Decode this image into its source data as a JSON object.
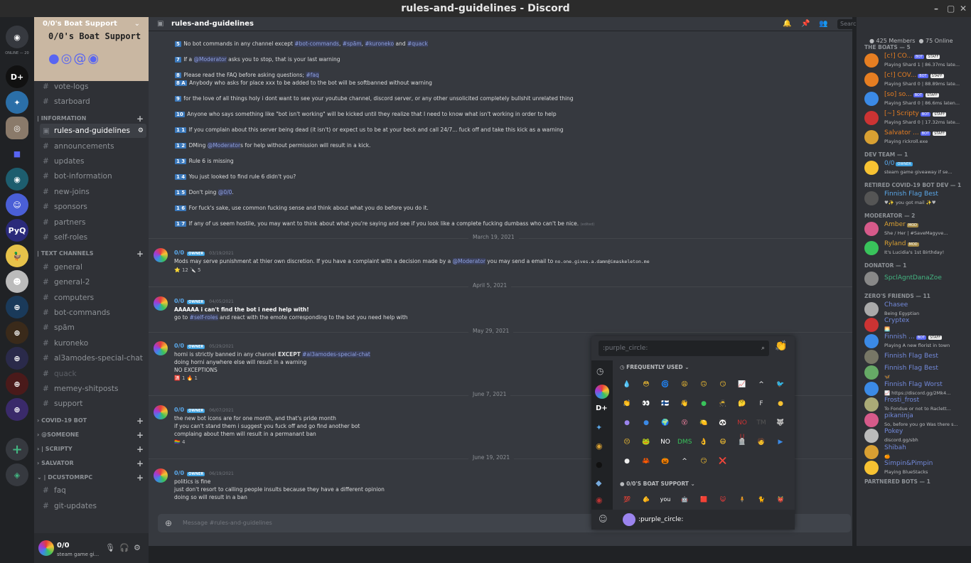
{
  "window": {
    "title": "rules-and-guidelines - Discord"
  },
  "guild_rail": {
    "online_label": "ONLINE — 20"
  },
  "server": {
    "name": "0/0's Boat Support",
    "banner_title": "0/0's Boat Support"
  },
  "channels": {
    "top": [
      "vote-logs",
      "starboard"
    ],
    "categories": [
      {
        "name": "| INFORMATION",
        "items": [
          "rules-and-guidelines",
          "announcements",
          "updates",
          "bot-information",
          "new-joins",
          "sponsors",
          "partners",
          "self-roles"
        ]
      },
      {
        "name": "| TEXT CHANNELS",
        "items": [
          "general",
          "general-2",
          "computers",
          "bot-commands",
          "spām",
          "kuroneko",
          "al3amodes-special-chat",
          "quack",
          "memey-shitposts",
          "support"
        ]
      },
      {
        "name": "COVID-19 BOT"
      },
      {
        "name": "@SOMEONE"
      },
      {
        "name": "| SCRIPTY"
      },
      {
        "name": "SALVATOR"
      },
      {
        "name": "| DCUSTOMRPC",
        "items": [
          "faq",
          "git-updates"
        ]
      }
    ]
  },
  "user_panel": {
    "name": "0/0",
    "status": "steam game gi..."
  },
  "header": {
    "channel": "rules-and-guidelines",
    "search_placeholder": "Search"
  },
  "rules": [
    {
      "n": "5",
      "text": "No bot commands in any channel except",
      "m1": "#bot-commands",
      "m2": "#spām",
      "m3": "#kuroneko",
      "and": "and",
      "m4": "#quack"
    },
    {
      "n": "7",
      "pre": "If a",
      "m": "@Moderator",
      "text": "asks you to stop, that is your last warning"
    },
    {
      "n": "8",
      "text": "Please read the FAQ before asking questions;",
      "m": "#faq"
    },
    {
      "n": "8 A",
      "text": "Anybody who asks for place xxx to be added to the bot will be softbanned without warning"
    },
    {
      "n": "9",
      "text": "for the love of all things holy i dont want to see your youtube channel, discord server, or any other unsolicited completely bullshit unrelated thing"
    },
    {
      "n": "10",
      "text": "Anyone who says something like \"bot isn't working\" will be kicked until they realize that I need to know what isn't working in order to help"
    },
    {
      "n": "1 1",
      "text": "If you complain about this server being dead (it isn't) or expect us to be at your beck and call 24/7... fuck off and take this kick as a warning"
    },
    {
      "n": "1 2",
      "pre": "DMing",
      "m": "@Moderator",
      "text": "s for help without permission will result in a kick."
    },
    {
      "n": "1 3",
      "text": "Rule 6 is missing"
    },
    {
      "n": "1 4",
      "text": "You just looked to find rule 6 didn't you?"
    },
    {
      "n": "1 5",
      "pre": "Don't ping",
      "m": "@0/0",
      "text": "."
    },
    {
      "n": "1 6",
      "text": "For fuck's sake, use common fucking sense and think about what you do before you do it."
    },
    {
      "n": "1 7",
      "text": "If any of us seem hostile, you may want to think about what you're saying and see if you look like a complete fucking dumbass who can't be nice.",
      "edited": "(edited)"
    }
  ],
  "messages": [
    {
      "divider": "March 19, 2021",
      "author": "0/0",
      "badge": "OWNER",
      "date": "03/19/2021",
      "lines": [
        "Mods may serve punishment at thier own discretion. If you have a complaint with a decision made by a",
        "@Moderator",
        "you may send a email to",
        "no.one.gives.a.damn@imaskeleton.me"
      ],
      "reactions": "⭐ 12   🔪 5"
    },
    {
      "divider": "April 5, 2021",
      "author": "0/0",
      "badge": "OWNER",
      "date": "04/05/2021",
      "lines": [
        "AAAAAA i can't find the bot i need help with!",
        "go to",
        "#self-roles",
        "and react with the emote corresponding to the bot you need help with"
      ]
    },
    {
      "divider": "May 29, 2021",
      "author": "0/0",
      "badge": "OWNER",
      "date": "05/29/2021",
      "lines": [
        "horni is strictly banned in any channel",
        "EXCEPT",
        "#al3amodes-special-chat",
        "doing horni anywhere else will result in a warning",
        "NO EXCEPTIONS"
      ],
      "reactions": "🈵 1   🔥 1"
    },
    {
      "divider": "June 7, 2021",
      "author": "0/0",
      "badge": "OWNER",
      "date": "06/07/2021",
      "lines": [
        "the new bot icons are for one month, and that's pride month",
        "if you can't stand them i suggest you fuck off and go find another bot",
        "complaing about them will result in a permanant ban"
      ],
      "reactions": "🏳️‍🌈 4"
    },
    {
      "divider": "June 19, 2021",
      "author": "0/0",
      "badge": "OWNER",
      "date": "06/19/2021",
      "lines": [
        "politics is fine",
        "just don't resort to calling people insults because they have a different opinion",
        "doing so will result in a ban"
      ]
    }
  ],
  "composer": {
    "placeholder": "Message #rules-and-guidelines"
  },
  "emoji_picker": {
    "search_placeholder": ":purple_circle:",
    "frequently_used": "FREQUENTLY USED",
    "server_section": "0/0'S BOAT SUPPORT",
    "footer_name": ":purple_circle:",
    "emojis": [
      "💧",
      "😳",
      "🌀",
      "😫",
      "🙃",
      "😏",
      "📈",
      "^",
      "🐦",
      "👏",
      "👀",
      "🇫🇮",
      "👋",
      "●",
      "🥷",
      "🤔",
      "F",
      "●",
      "●",
      "●",
      "🌍",
      "😵",
      "🍋",
      "🐼",
      "NO U",
      "TM",
      "🐺",
      "😣",
      "🐸",
      "NO",
      "DMS",
      "👌",
      "😷",
      "🪦",
      "🧑",
      "▶",
      "●",
      "🦀",
      "🎃",
      "^",
      "😏",
      "❌",
      "💯",
      "🫵",
      "you tried",
      "🤖",
      "🟥",
      "😺",
      "🧍",
      "🐈",
      "👹"
    ]
  },
  "members_header": {
    "members": "425 Members",
    "online": "75 Online"
  },
  "member_groups": [
    {
      "title": "THE BOATS — 5",
      "members": [
        {
          "name": "[c!] CO...",
          "tag": "BOT",
          "staff": "STAFF",
          "status": "Playing Shard 1 | 86.37ms late..."
        },
        {
          "name": "[c!] COV...",
          "tag": "BOT",
          "staff": "STAFF",
          "status": "Playing Shard 0 | 88.89ms late..."
        },
        {
          "name": "[so] so...",
          "tag": "BOT",
          "staff": "STAFF",
          "status": "Playing Shard 0 | 86.6ms laten..."
        },
        {
          "name": "[~] Scripty",
          "tag": "BOT",
          "staff": "STAFF",
          "status": "Playing Shard 0 | 17.32ms late..."
        },
        {
          "name": "Salvator ...",
          "tag": "BOT",
          "staff": "STAFF",
          "status": "Playing rickroll.exe"
        }
      ]
    },
    {
      "title": "DEV TEAM — 1",
      "members": [
        {
          "name": "0/0",
          "tag": "OWNER",
          "status": "steam game giveaway if se..."
        }
      ]
    },
    {
      "title": "RETIRED COVID-19 BOT DEV — 1",
      "members": [
        {
          "name": "Finnish Flag Best",
          "status": "♥✨ you got mail ✨♥"
        }
      ]
    },
    {
      "title": "MODERATOR — 2",
      "members": [
        {
          "name": "Amber",
          "tag": "MOD",
          "status": "She / Her | #SaveMagyve..."
        },
        {
          "name": "Ryland",
          "tag": "MOD",
          "status": "It's Lucidia's 1st Birthday!"
        }
      ]
    },
    {
      "title": "DONATOR — 1",
      "members": [
        {
          "name": "SpclAgntDanaZoe"
        }
      ]
    },
    {
      "title": "ZERO'S FRIENDS — 11",
      "members": [
        {
          "name": "Chasee",
          "status": "Being Egyptian"
        },
        {
          "name": "Cryptex",
          "status": "🌅"
        },
        {
          "name": "Finnish ...",
          "tag": "BOT",
          "staff": "STAFF",
          "status": "Playing A new florist in town"
        },
        {
          "name": "Finnish Flag Best"
        },
        {
          "name": "Finnish Flag Best",
          "status": "🦋"
        },
        {
          "name": "Finnish Flag Worst",
          "status": "📈 https://discord.gg/2Mk4..."
        },
        {
          "name": "Frosti_frost",
          "status": "To Fondue or not to Raclett..."
        },
        {
          "name": "pikaninja",
          "status": "So, before you go Was there s..."
        },
        {
          "name": "Pokey",
          "status": "discord.gg/sbh"
        },
        {
          "name": "Shibah",
          "status": "🍊"
        },
        {
          "name": "Simpin&Pimpin",
          "status": "Playing BlueStacks"
        }
      ]
    },
    {
      "title": "PARTNERED BOTS — 1",
      "members": []
    }
  ]
}
